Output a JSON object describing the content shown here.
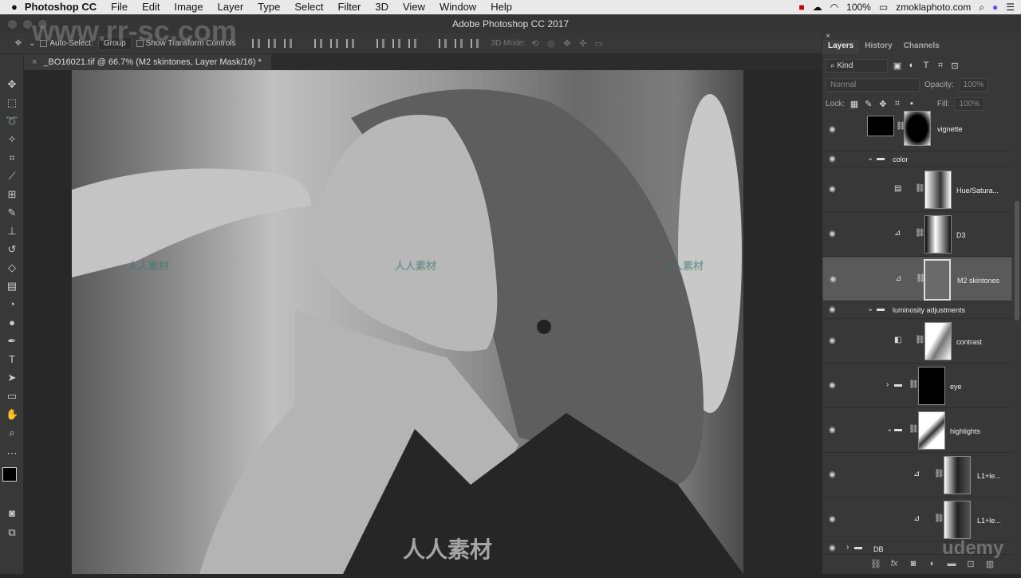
{
  "menubar": {
    "apple": "",
    "app": "Photoshop CC",
    "items": [
      "File",
      "Edit",
      "Image",
      "Layer",
      "Type",
      "Select",
      "Filter",
      "3D",
      "View",
      "Window",
      "Help"
    ],
    "battery": "100%",
    "user": "zmoklaphoto.com"
  },
  "window": {
    "title": "Adobe Photoshop CC 2017"
  },
  "options": {
    "auto_select": "Auto-Select:",
    "group": "Group",
    "show_transform": "Show Transform Controls",
    "mode3d": "3D Mode:"
  },
  "document_tab": {
    "title": "_BO16021.tif @ 66.7% (M2 skintones, Layer Mask/16) *"
  },
  "panel": {
    "tabs": [
      "Layers",
      "History",
      "Channels"
    ],
    "active_tab": "Layers",
    "filter": "Kind",
    "blend": "Normal",
    "opacity_label": "Opacity:",
    "opacity": "100%",
    "lock_label": "Lock:",
    "fill_label": "Fill:",
    "fill": "100%"
  },
  "layers": [
    {
      "name": "vignette",
      "type": "layer"
    },
    {
      "name": "color",
      "type": "group",
      "expanded": true
    },
    {
      "name": "Hue/Satura...",
      "type": "hue-saturation"
    },
    {
      "name": "D3",
      "type": "curves"
    },
    {
      "name": "M2 skintones",
      "type": "curves",
      "selected": true
    },
    {
      "name": "luminosity adjustments",
      "type": "group",
      "expanded": true
    },
    {
      "name": "contrast",
      "type": "levels"
    },
    {
      "name": "eye",
      "type": "group",
      "expanded": false
    },
    {
      "name": "highlights",
      "type": "group",
      "expanded": true
    },
    {
      "name": "L1+le...",
      "type": "curves"
    },
    {
      "name": "L1+le...",
      "type": "curves"
    },
    {
      "name": "DB",
      "type": "group",
      "expanded": false
    }
  ],
  "watermarks": {
    "site": "www.rr-sc.com",
    "cn": "人人素材",
    "brand": "udemy"
  }
}
